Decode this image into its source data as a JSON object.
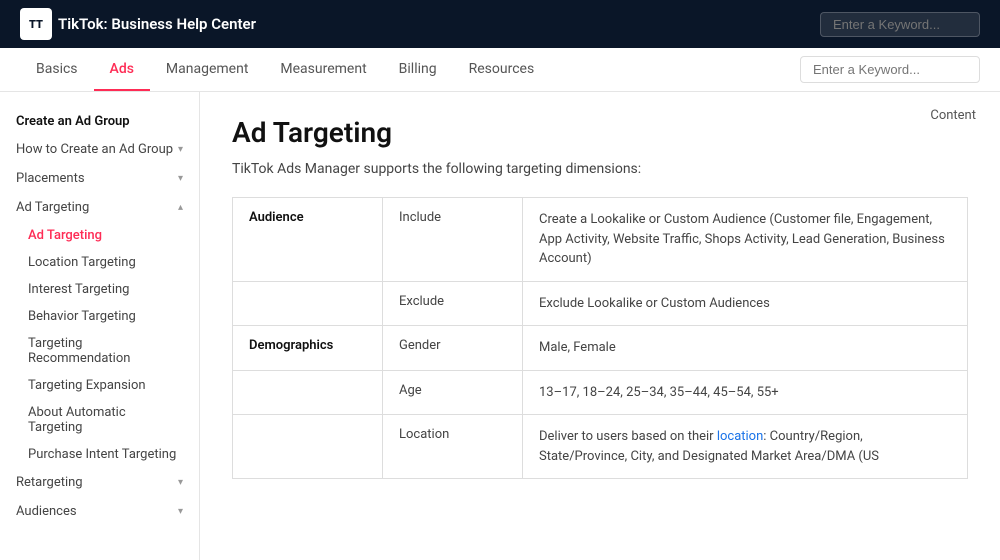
{
  "topNav": {
    "logoText": "TikTok",
    "subTitle": ": Business Help Center",
    "searchPlaceholder": "Enter a Keyword..."
  },
  "subNav": {
    "tabs": [
      {
        "label": "Basics",
        "active": false
      },
      {
        "label": "Ads",
        "active": true
      },
      {
        "label": "Management",
        "active": false
      },
      {
        "label": "Measurement",
        "active": false
      },
      {
        "label": "Billing",
        "active": false
      },
      {
        "label": "Resources",
        "active": false
      }
    ],
    "searchPlaceholder": "Enter a Keyword..."
  },
  "sidebar": {
    "topSection": {
      "label": "Create an Ad Group"
    },
    "items": [
      {
        "label": "How to Create an Ad Group",
        "hasChevron": true,
        "expanded": false,
        "active": false
      },
      {
        "label": "Placements",
        "hasChevron": true,
        "expanded": false,
        "active": false
      },
      {
        "label": "Ad Targeting",
        "hasChevron": true,
        "expanded": true,
        "active": false,
        "subItems": [
          {
            "label": "Ad Targeting",
            "active": true
          },
          {
            "label": "Location Targeting",
            "active": false
          },
          {
            "label": "Interest Targeting",
            "active": false
          },
          {
            "label": "Behavior Targeting",
            "active": false
          },
          {
            "label": "Targeting Recommendation",
            "active": false
          },
          {
            "label": "Targeting Expansion",
            "active": false
          },
          {
            "label": "About Automatic Targeting",
            "active": false
          },
          {
            "label": "Purchase Intent Targeting",
            "active": false
          }
        ]
      },
      {
        "label": "Retargeting",
        "hasChevron": true,
        "expanded": false,
        "active": false
      },
      {
        "label": "Audiences",
        "hasChevron": true,
        "expanded": false,
        "active": false
      }
    ]
  },
  "mainContent": {
    "contentLabel": "Content",
    "pageTitle": "Ad Targeting",
    "introText": "TikTok Ads Manager supports the following targeting dimensions:",
    "tableRows": [
      {
        "category": "Audience",
        "type": "Include",
        "description": "Create a Lookalike or Custom Audience (Customer file, Engagement, App Activity, Website Traffic, Shops Activity, Lead Generation, Business Account)"
      },
      {
        "category": "",
        "type": "Exclude",
        "description": "Exclude Lookalike or Custom Audiences"
      },
      {
        "category": "Demographics",
        "type": "Gender",
        "description": "Male, Female"
      },
      {
        "category": "",
        "type": "Age",
        "description": "13–17, 18–24, 25–34, 35–44, 45–54, 55+"
      },
      {
        "category": "",
        "type": "Location",
        "description": "Deliver to users based on their location: Country/Region, State/Province, City, and Designated Market Area/DMA (US"
      }
    ]
  }
}
